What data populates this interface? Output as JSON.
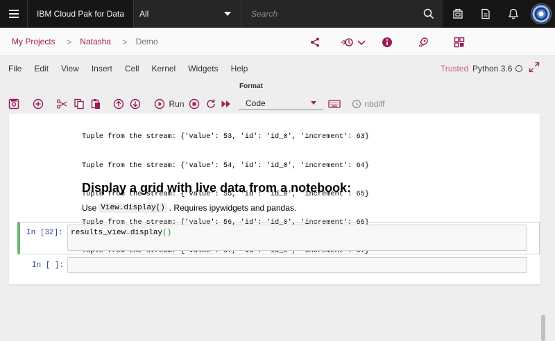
{
  "topbar": {
    "brand": "IBM Cloud Pak for Data",
    "scope_value": "All",
    "search_placeholder": "Search",
    "icons": [
      "menu-icon",
      "search-icon",
      "catalog-icon",
      "document-icon",
      "notification-icon",
      "avatar"
    ]
  },
  "breadcrumb": {
    "items": [
      "My Projects",
      "Natasha"
    ],
    "current": "Demo",
    "actions": [
      "share-icon",
      "version-history-icon",
      "info-icon",
      "deploy-icon",
      "assets-icon"
    ]
  },
  "notebook_menu": {
    "items": [
      "File",
      "Edit",
      "View",
      "Insert",
      "Cell",
      "Kernel",
      "Widgets",
      "Help"
    ],
    "trusted": "Trusted",
    "kernel": "Python 3.6"
  },
  "toolbar": {
    "format_label": "Format",
    "run_label": "Run",
    "cell_type": "Code",
    "nbdiff_label": "nbdiff"
  },
  "output_lines": [
    "Tuple from the stream: {'value': 53, 'id': 'id_0', 'increment': 63}",
    "Tuple from the stream: {'value': 54, 'id': 'id_0', 'increment': 64}",
    "Tuple from the stream: {'value': 55, 'id': 'id_0', 'increment': 65}",
    "Tuple from the stream: {'value': 56, 'id': 'id_0', 'increment': 66}",
    "Tuple from the stream: {'value': 57, 'id': 'id_0', 'increment': 67}"
  ],
  "markdown": {
    "heading": "Display a grid with live data from a notebook:",
    "use": "Use",
    "code": "View.display()",
    "rest": ". Requires ipywidgets and pandas."
  },
  "cells": [
    {
      "prompt": "In [32]:",
      "code_name": "results_view.display",
      "code_paren": "()"
    },
    {
      "prompt": "In [ ]:",
      "code_name": "",
      "code_paren": ""
    }
  ],
  "colors": {
    "accent": "#9b1c57",
    "topbar": "#161616",
    "trusted": "#c35d8c",
    "selected_cell": "#66bb6a",
    "prompt": "#303f9f"
  }
}
